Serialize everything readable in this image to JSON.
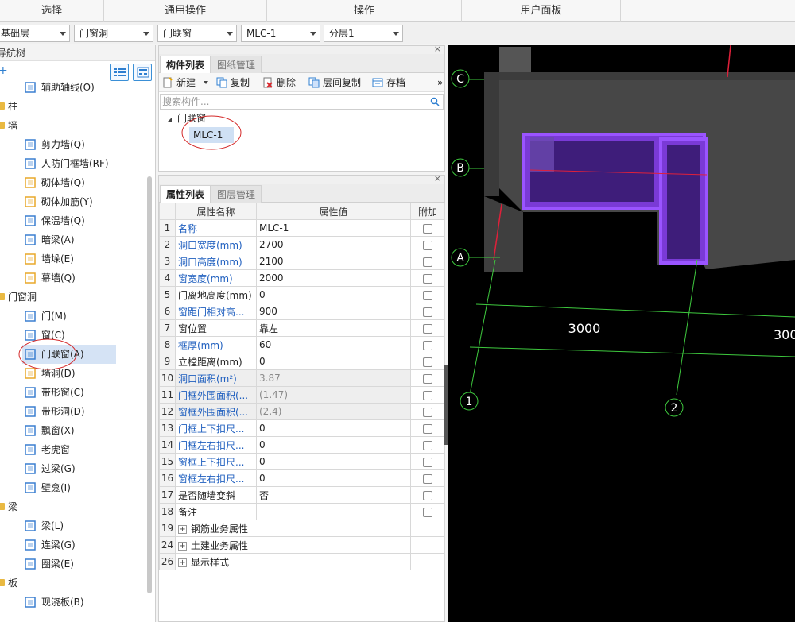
{
  "ribbon": {
    "groups": [
      "选择",
      "通用操作",
      "操作",
      "用户面板"
    ]
  },
  "selectors": {
    "floor": "基础层",
    "category": "门窗洞",
    "type": "门联窗",
    "component": "MLC-1",
    "layer": "分层1"
  },
  "nav": {
    "title": "导航树",
    "items": [
      {
        "label": "辅助轴线(O)",
        "icon": "grid-axis-icon"
      },
      {
        "label": "柱",
        "icon": "folder-icon"
      },
      {
        "label": "墙",
        "icon": "folder-icon"
      },
      {
        "label": "剪力墙(Q)",
        "icon": "shear-wall-icon"
      },
      {
        "label": "人防门框墙(RF)",
        "icon": "door-frame-wall-icon"
      },
      {
        "label": "砌体墙(Q)",
        "icon": "masonry-wall-icon"
      },
      {
        "label": "砌体加筋(Y)",
        "icon": "masonry-rebar-icon"
      },
      {
        "label": "保温墙(Q)",
        "icon": "insulation-wall-icon"
      },
      {
        "label": "暗梁(A)",
        "icon": "hidden-beam-icon"
      },
      {
        "label": "墙垛(E)",
        "icon": "wall-pier-icon"
      },
      {
        "label": "幕墙(Q)",
        "icon": "curtain-wall-icon"
      },
      {
        "label": "门窗洞",
        "icon": "folder-icon"
      },
      {
        "label": "门(M)",
        "icon": "door-icon"
      },
      {
        "label": "窗(C)",
        "icon": "window-icon"
      },
      {
        "label": "门联窗(A)",
        "icon": "door-window-icon"
      },
      {
        "label": "墙洞(D)",
        "icon": "wall-opening-icon"
      },
      {
        "label": "带形窗(C)",
        "icon": "strip-window-icon"
      },
      {
        "label": "带形洞(D)",
        "icon": "strip-opening-icon"
      },
      {
        "label": "飘窗(X)",
        "icon": "bay-window-icon"
      },
      {
        "label": "老虎窗",
        "icon": "dormer-icon"
      },
      {
        "label": "过梁(G)",
        "icon": "lintel-icon"
      },
      {
        "label": "壁龛(I)",
        "icon": "niche-icon"
      },
      {
        "label": "梁",
        "icon": "folder-icon"
      },
      {
        "label": "梁(L)",
        "icon": "beam-icon"
      },
      {
        "label": "连梁(G)",
        "icon": "coupling-beam-icon"
      },
      {
        "label": "圈梁(E)",
        "icon": "ring-beam-icon"
      },
      {
        "label": "板",
        "icon": "folder-icon"
      },
      {
        "label": "现浇板(B)",
        "icon": "cast-slab-icon"
      }
    ]
  },
  "component_panel": {
    "tabs": [
      "构件列表",
      "图纸管理"
    ],
    "toolbar": {
      "new": "新建",
      "copy": "复制",
      "delete": "删除",
      "floor_copy": "层间复制",
      "save": "存档",
      "more": "»"
    },
    "search_placeholder": "搜索构件...",
    "tree_root": "门联窗",
    "tree_child": "MLC-1"
  },
  "property_panel": {
    "tabs": [
      "属性列表",
      "图层管理"
    ],
    "headers": {
      "name": "属性名称",
      "value": "属性值",
      "extra": "附加"
    },
    "rows": [
      {
        "no": "1",
        "name": "名称",
        "value": "MLC-1"
      },
      {
        "no": "2",
        "name": "洞口宽度(mm)",
        "value": "2700"
      },
      {
        "no": "3",
        "name": "洞口高度(mm)",
        "value": "2100"
      },
      {
        "no": "4",
        "name": "窗宽度(mm)",
        "value": "2000"
      },
      {
        "no": "5",
        "name": "门离地高度(mm)",
        "value": "0"
      },
      {
        "no": "6",
        "name": "窗距门相对高...",
        "value": "900"
      },
      {
        "no": "7",
        "name": "窗位置",
        "value": "靠左"
      },
      {
        "no": "8",
        "name": "框厚(mm)",
        "value": "60"
      },
      {
        "no": "9",
        "name": "立樘距离(mm)",
        "value": "0"
      },
      {
        "no": "10",
        "name": "洞口面积(m²)",
        "value": "3.87"
      },
      {
        "no": "11",
        "name": "门框外围面积(...",
        "value": "(1.47)"
      },
      {
        "no": "12",
        "name": "窗框外围面积(...",
        "value": "(2.4)"
      },
      {
        "no": "13",
        "name": "门框上下扣尺...",
        "value": "0"
      },
      {
        "no": "14",
        "name": "门框左右扣尺...",
        "value": "0"
      },
      {
        "no": "15",
        "name": "窗框上下扣尺...",
        "value": "0"
      },
      {
        "no": "16",
        "name": "窗框左右扣尺...",
        "value": "0"
      },
      {
        "no": "17",
        "name": "是否随墙变斜",
        "value": "否"
      },
      {
        "no": "18",
        "name": "备注",
        "value": ""
      }
    ],
    "groups": [
      {
        "no": "19",
        "name": "钢筋业务属性"
      },
      {
        "no": "24",
        "name": "土建业务属性"
      },
      {
        "no": "26",
        "name": "显示样式"
      }
    ]
  },
  "viewport": {
    "axis_rows": [
      "C",
      "B",
      "A"
    ],
    "axis_cols": [
      "1",
      "2"
    ],
    "dimensions": [
      "3000",
      "300"
    ],
    "colors": {
      "background": "#000000",
      "wall": "#4a4a4a",
      "window": "#8a3cf0",
      "grid": "#3ec93e",
      "axis_red": "#e0203a"
    }
  }
}
